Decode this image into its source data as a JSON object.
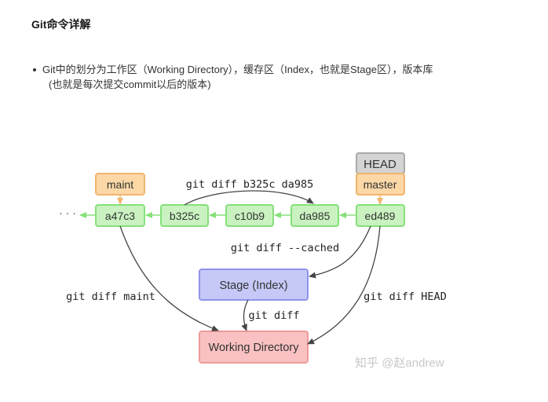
{
  "heading": "Git命令详解",
  "bullet": {
    "line1": "Git中的划分为工作区（Working Directory），缓存区（Index，也就是Stage区），版本库",
    "line2": "(也就是每次提交commit以后的版本)"
  },
  "diagram": {
    "ellipsis": "· · ·",
    "refs": {
      "head": "HEAD",
      "master": "master",
      "maint": "maint"
    },
    "commits": [
      "a47c3",
      "b325c",
      "c10b9",
      "da985",
      "ed489"
    ],
    "areas": {
      "stage": "Stage (Index)",
      "working": "Working Directory"
    },
    "commands": {
      "diff_commits": "git diff b325c da985",
      "diff_cached": "git diff --cached",
      "diff_maint": "git diff maint",
      "diff_head": "git diff HEAD",
      "diff": "git diff"
    },
    "colors": {
      "commit_fill": "#c9f2c0",
      "commit_stroke": "#86e07a",
      "ref_fill": "#fbd8a6",
      "ref_stroke": "#f2b56e",
      "head_fill": "#d4d4d4",
      "head_stroke": "#aaaaaa",
      "stage_fill": "#c6c9f7",
      "stage_stroke": "#8f94ea",
      "working_fill": "#f9c1c1",
      "working_stroke": "#ee9a9a",
      "arrow": "#444444",
      "commit_arrow": "#86e07a"
    }
  },
  "watermark": "知乎 @赵andrew"
}
